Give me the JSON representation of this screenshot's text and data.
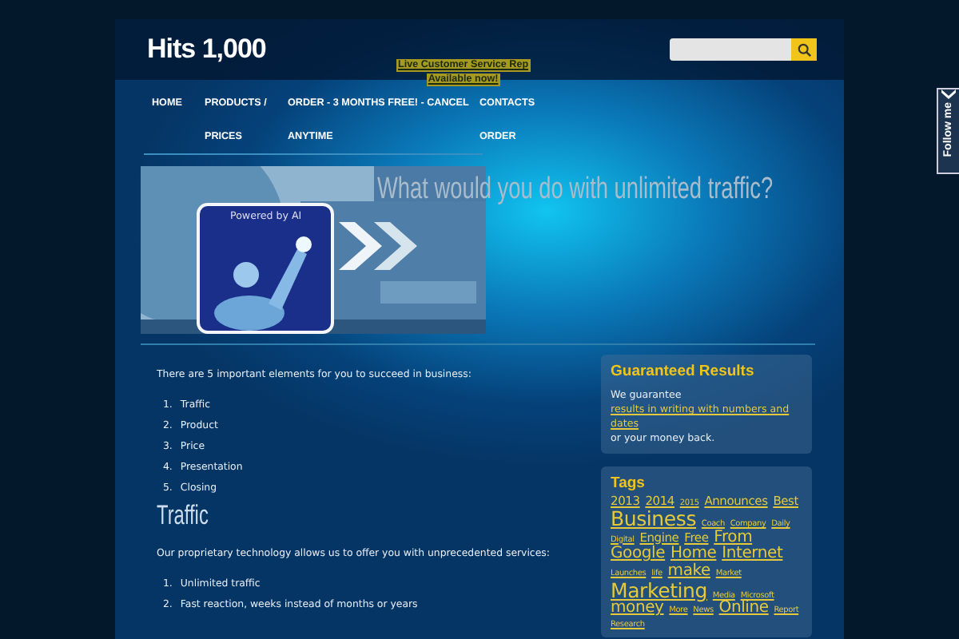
{
  "site_title": "Hits 1,000",
  "chat_notice": [
    "Live Customer Service Rep",
    "Available now!"
  ],
  "nav": [
    {
      "lines": [
        "HOME"
      ]
    },
    {
      "lines": [
        "PRODUCTS /",
        "PRICES"
      ]
    },
    {
      "lines": [
        "ORDER - 3 MONTHS FREE! - CANCEL",
        "ANYTIME"
      ]
    },
    {
      "lines": [
        "CONTACTS",
        "ORDER"
      ]
    }
  ],
  "banner": {
    "badge": "Powered by AI",
    "headline": "What would you do with unlimited traffic?"
  },
  "content": {
    "intro": "There are 5 important elements for you to succeed in business:",
    "elements": [
      {
        "number": "1.",
        "text": "Traffic"
      },
      {
        "number": "2.",
        "text": "Product"
      },
      {
        "number": "3.",
        "text": "Price"
      },
      {
        "number": "4.",
        "text": "Presentation"
      },
      {
        "number": "5.",
        "text": "Closing"
      }
    ],
    "heading": "Traffic",
    "services_intro": "Our proprietary technology allows us to offer you with unprecedented services:",
    "services": [
      {
        "number": "1.",
        "text": "Unlimited traffic"
      },
      {
        "number": "2.",
        "text": "Fast reaction, weeks instead of months or years"
      }
    ]
  },
  "guarantee": {
    "title": "Guaranteed Results",
    "before": "We guarantee ",
    "link": "results in writing with numbers and dates",
    "after": " or your money back."
  },
  "tags": {
    "title": "Tags",
    "items": [
      {
        "label": "2013",
        "kind": "medium"
      },
      {
        "label": "2014",
        "kind": "medium"
      },
      {
        "label": "2015",
        "kind": "small"
      },
      {
        "label": "Announces",
        "kind": "medium"
      },
      {
        "label": "Best",
        "kind": "medium"
      },
      {
        "label": "Business",
        "kind": "huge"
      },
      {
        "label": "Coach",
        "kind": "small"
      },
      {
        "label": "Company",
        "kind": "small"
      },
      {
        "label": "Daily",
        "kind": "small"
      },
      {
        "label": "Digital",
        "kind": "small"
      },
      {
        "label": "Engine",
        "kind": "medium"
      },
      {
        "label": "Free",
        "kind": "medium"
      },
      {
        "label": "From",
        "kind": "large"
      },
      {
        "label": "Google",
        "kind": "large"
      },
      {
        "label": "Home",
        "kind": "large"
      },
      {
        "label": "Internet",
        "kind": "large"
      },
      {
        "label": "Launches",
        "kind": "small"
      },
      {
        "label": "life",
        "kind": "small"
      },
      {
        "label": "make",
        "kind": "large"
      },
      {
        "label": "Market",
        "kind": "small"
      },
      {
        "label": "Marketing",
        "kind": "huge"
      },
      {
        "label": "Media",
        "kind": "small"
      },
      {
        "label": "Microsoft",
        "kind": "small"
      },
      {
        "label": "money",
        "kind": "large"
      },
      {
        "label": "More",
        "kind": "small"
      },
      {
        "label": "News",
        "kind": "small"
      },
      {
        "label": "Online",
        "kind": "large"
      },
      {
        "label": "Report",
        "kind": "small"
      },
      {
        "label": "Research",
        "kind": "small"
      }
    ]
  },
  "follow_tab": {
    "label": "Follow me"
  }
}
